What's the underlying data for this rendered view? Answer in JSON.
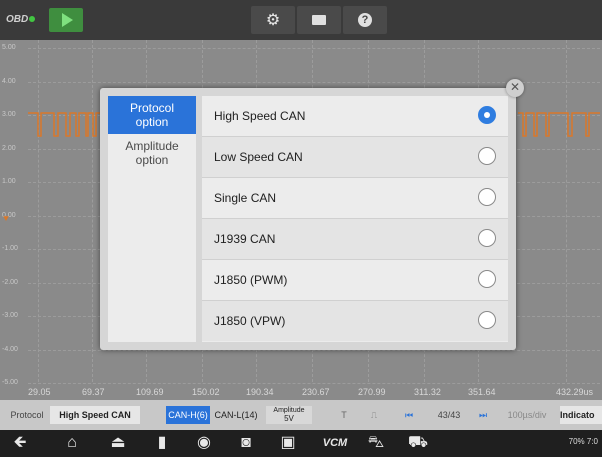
{
  "topbar": {
    "logo": "OBD",
    "icons": [
      "play-icon",
      "gear-icon",
      "folder-icon",
      "help-icon"
    ]
  },
  "scope": {
    "y_ticks": [
      "5.00",
      "4.00",
      "3.00",
      "2.00",
      "1.00",
      "0.00",
      "-1.00",
      "-2.00",
      "-3.00",
      "-4.00",
      "-5.00"
    ],
    "x_ticks": [
      "29.05",
      "69.37",
      "109.69",
      "150.02",
      "190.34",
      "230.67",
      "270.99",
      "311.32",
      "351.64",
      "432.29us"
    ]
  },
  "dialog": {
    "tabs": [
      "Protocol option",
      "Amplitude option"
    ],
    "options": [
      {
        "label": "High Speed CAN",
        "selected": true
      },
      {
        "label": "Low Speed CAN",
        "selected": false
      },
      {
        "label": "Single CAN",
        "selected": false
      },
      {
        "label": "J1939 CAN",
        "selected": false
      },
      {
        "label": "J1850 (PWM)",
        "selected": false
      },
      {
        "label": "J1850 (VPW)",
        "selected": false
      }
    ]
  },
  "bottombar": {
    "protocol_label": "Protocol",
    "protocol_value": "High Speed CAN",
    "can_h": "CAN-H(6)",
    "can_l": "CAN-L(14)",
    "amplitude_label": "Amplitude",
    "amplitude_value": "5V",
    "t_label": "T",
    "page": "43/43",
    "timebase": "100µs/div",
    "indicator": "Indicato"
  },
  "statusbar": {
    "status_text": "70% 7:0"
  },
  "colors": {
    "accent": "#2a73d9",
    "signal": "#d9782a",
    "play": "#3f8e3f"
  }
}
